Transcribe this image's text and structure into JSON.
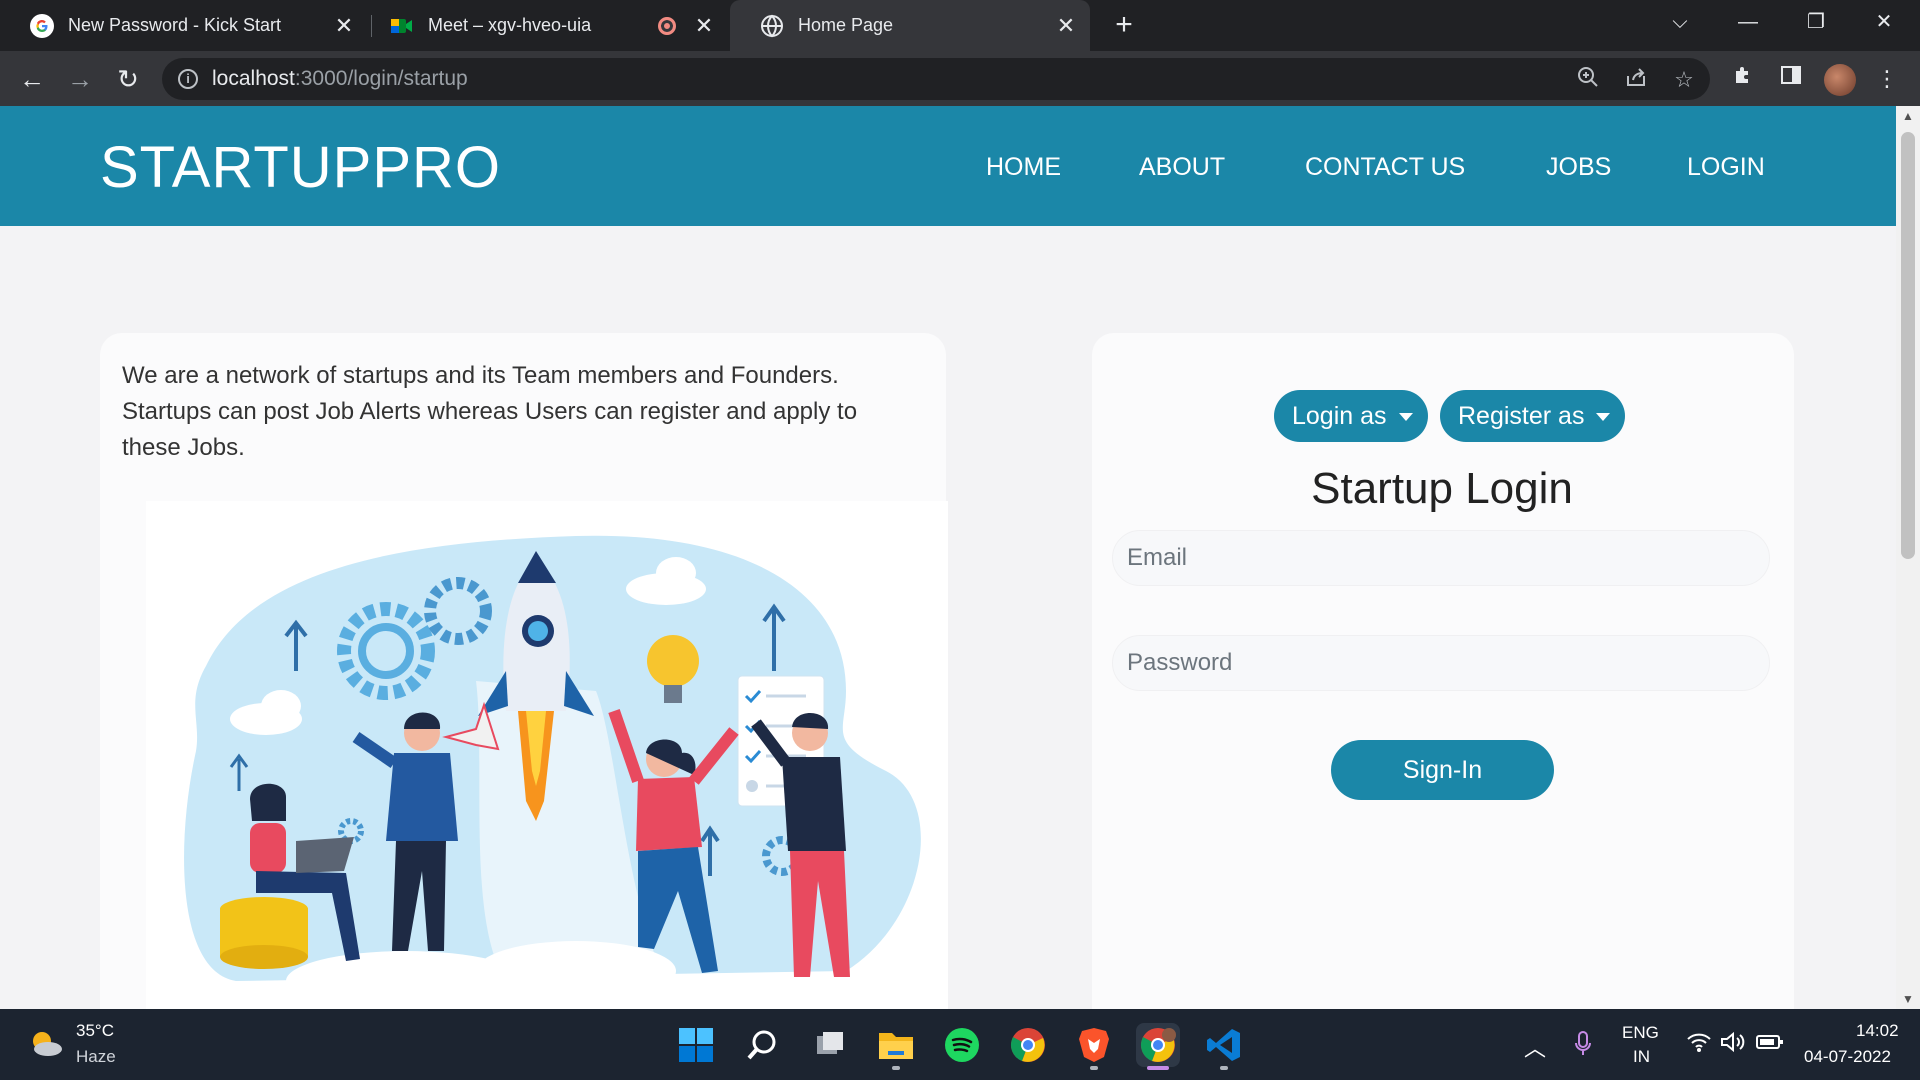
{
  "browser": {
    "tabs": [
      {
        "title": "New Password - Kick Start",
        "close": "✕"
      },
      {
        "title": "Meet – xgv-hveo-uia",
        "close": "✕"
      },
      {
        "title": "Home Page",
        "close": "✕"
      }
    ],
    "new_tab": "+",
    "window_controls": {
      "dropdown": "⌵",
      "minimize": "—",
      "restore": "❐",
      "close": "✕"
    },
    "url_host": "localhost",
    "url_path": ":3000/login/startup",
    "icons": [
      "back-icon",
      "forward-icon",
      "reload-icon",
      "info-icon",
      "zoom-icon",
      "share-icon",
      "star-icon",
      "extensions-icon",
      "sidepanel-icon",
      "menu-icon"
    ]
  },
  "site": {
    "brand": "STARTUPPRO",
    "nav": [
      "HOME",
      "ABOUT",
      "CONTACT US",
      "JOBS",
      "LOGIN"
    ],
    "intro": "We are a network of startups and its Team members and Founders. Startups can post Job Alerts whereas Users can register and apply to these Jobs.",
    "login_as": "Login as",
    "register_as": "Register as",
    "login_title": "Startup Login",
    "email_placeholder": "Email",
    "password_placeholder": "Password",
    "signin": "Sign-In",
    "accent": "#1b87a8"
  },
  "taskbar": {
    "temperature": "35°C",
    "condition": "Haze",
    "lang_top": "ENG",
    "lang_bottom": "IN",
    "time": "14:02",
    "date": "04-07-2022",
    "apps": [
      "start-icon",
      "search-icon",
      "taskview-icon",
      "file-explorer-icon",
      "spotify-icon",
      "chrome-icon",
      "brave-icon",
      "chrome-profile-icon",
      "vscode-icon"
    ]
  }
}
